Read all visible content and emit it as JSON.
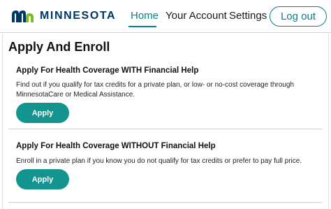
{
  "header": {
    "logo_text": "MINNESOTA",
    "nav": {
      "home": "Home",
      "account": "Your Account",
      "settings": "Settings"
    },
    "logout_label": "Log out"
  },
  "page": {
    "title": "Apply And Enroll"
  },
  "sections": [
    {
      "title": "Apply For Health Coverage WITH Financial Help",
      "description": "Find out if you qualify for tax credits for a private plan, or low- or no-cost coverage through MinnesotaCare or Medical Assistance.",
      "button_label": "Apply"
    },
    {
      "title": "Apply For Health Coverage WITHOUT Financial Help",
      "description": "Enroll in a private plan if you know you do not qualify for tax credits or prefer to pay full price.",
      "button_label": "Apply"
    }
  ],
  "colors": {
    "accent": "#0b7f8c",
    "button": "#14948f",
    "logo_blue": "#003865",
    "logo_green": "#78be20"
  },
  "icons": {
    "logo": "mn-logo-icon"
  }
}
